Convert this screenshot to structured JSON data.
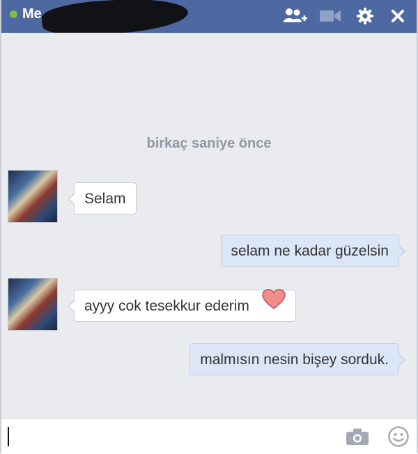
{
  "titlebar": {
    "contact_name": "Me",
    "status_color": "#7bc043",
    "icons": [
      "add-friend-icon",
      "video-call-icon",
      "gear-icon",
      "close-icon"
    ]
  },
  "conversation": {
    "timestamp": "birkaç saniye önce",
    "messages": [
      {
        "direction": "incoming",
        "text": "Selam"
      },
      {
        "direction": "outgoing",
        "text": "selam ne kadar güzelsin"
      },
      {
        "direction": "incoming",
        "text": "ayyy cok tesekkur ederim",
        "emoji": "heart-icon"
      },
      {
        "direction": "outgoing",
        "text": "malmısın nesin bişey sorduk."
      }
    ]
  },
  "composer": {
    "value": "",
    "icons": [
      "camera-icon",
      "emoji-smiley-icon"
    ]
  }
}
